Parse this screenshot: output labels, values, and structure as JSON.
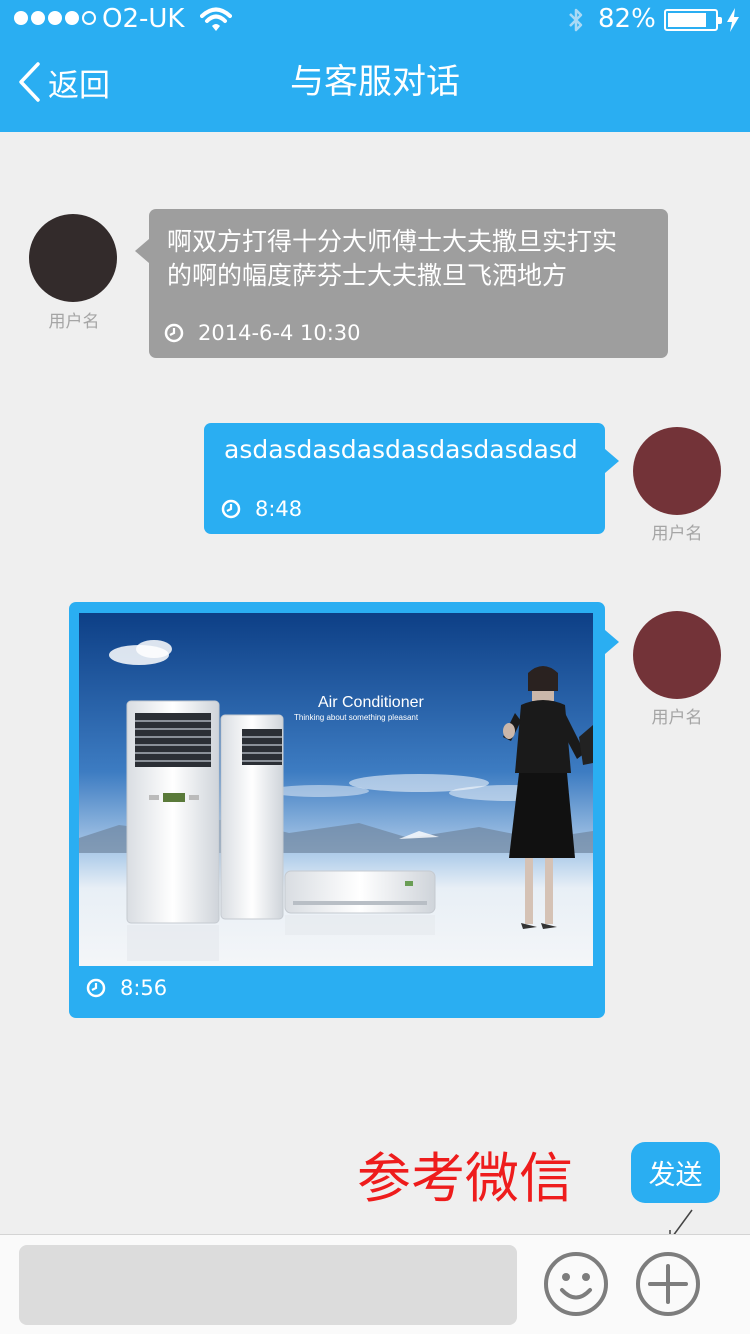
{
  "status_bar": {
    "carrier": "O2-UK",
    "battery_percent": "82%",
    "battery_level": 0.82,
    "signal_bars": 4
  },
  "nav": {
    "back_label": "返回",
    "title": "与客服对话"
  },
  "messages": [
    {
      "side": "left",
      "username": "用户名",
      "avatar_color": "#332b2b",
      "text": "啊双方打得十分大师傅士大夫撒旦实打实的啊的幅度萨芬士大夫撒旦飞洒地方",
      "time": "2014-6-4  10:30"
    },
    {
      "side": "right",
      "username": "用户名",
      "avatar_color": "#733338",
      "text": "asdasdasdasdasdasdasdasd",
      "time": "8:48"
    },
    {
      "side": "right",
      "type": "image",
      "username": "用户名",
      "avatar_color": "#733338",
      "image": {
        "title": "Air Conditioner",
        "subtitle": "Thinking about something pleasant"
      },
      "time": "8:56"
    }
  ],
  "annotation": "参考微信",
  "composer": {
    "send_label": "发送",
    "input_value": "",
    "emoji_icon": "smiley-icon",
    "add_icon": "plus-circle-icon"
  },
  "colors": {
    "primary": "#2aaef2",
    "gray_bubble": "#9e9e9e",
    "annotation": "#ee1c1c"
  }
}
